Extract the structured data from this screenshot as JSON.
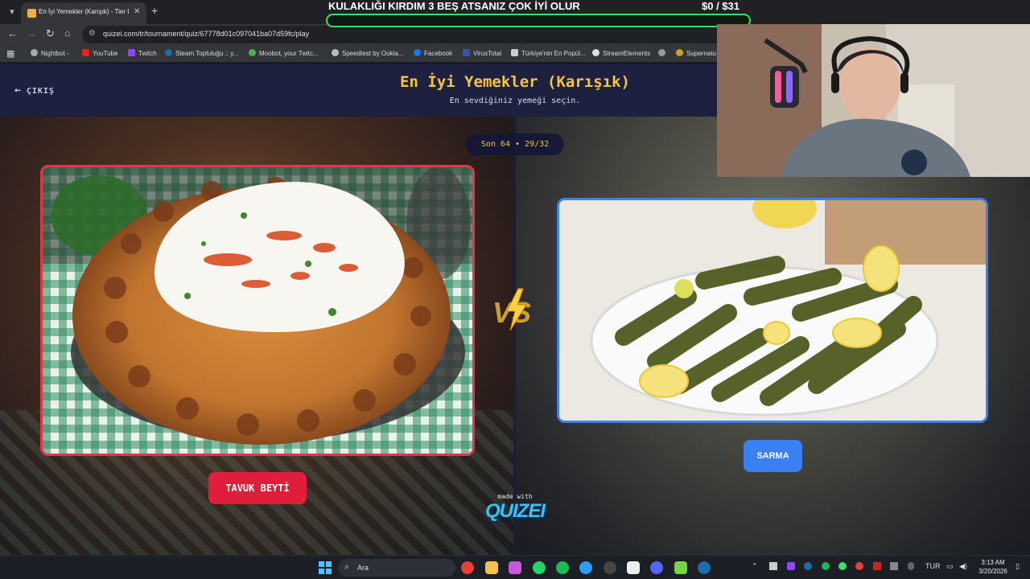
{
  "browser": {
    "tab_title": "En İyi Yemekler (Karışık) - Tier L",
    "url": "quizei.com/tr/tournament/quiz/67778d01c097041ba07d59fc/play",
    "bookmarks": [
      "Nightbot -",
      "YouTube",
      "Twitch",
      "Steam Topluluğu :: y...",
      "Moobot, your Twitc...",
      "Speedtest by Ookla...",
      "Facebook",
      "VirusTotal",
      "Türkiye'nin En Popül...",
      "StreamElements",
      "",
      "Supernatu"
    ]
  },
  "overlay": {
    "message": "KULAKLIĞI KIRDIM 3 BEŞ ATSANIZ ÇOK İYİ OLUR",
    "money": "$0   / $31",
    "progress": 0.0,
    "bar_color": "#3ddc6b"
  },
  "quiz": {
    "exit_label": "ÇIKIŞ",
    "title": "En İyi Yemekler (Karışık)",
    "subtitle": "En sevdiğiniz yemeği seçin.",
    "round": "Son 64 • 29/32",
    "left_choice": "TAVUK BEYTİ",
    "right_choice": "SARMA",
    "made_with": "made with",
    "brand": "QUIZEI",
    "accent": "#f5c542",
    "left_color": "#e01e3c",
    "right_color": "#3b7ff5"
  },
  "taskbar": {
    "search_placeholder": "Ara",
    "language": "TUR",
    "time": "3:13 AM",
    "date": "3/20/2026"
  }
}
